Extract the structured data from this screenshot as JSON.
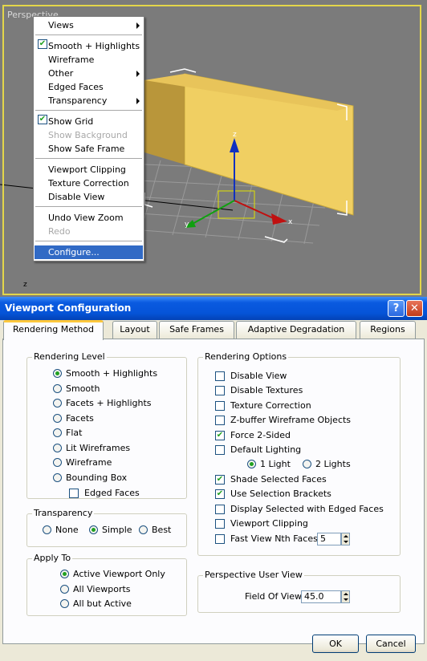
{
  "viewport": {
    "label": "Perspective",
    "axis_label_z": "z",
    "gizmo_z": "z",
    "gizmo_x": "x",
    "gizmo_y": "y"
  },
  "context_menu": {
    "items": [
      {
        "label": "Views",
        "checked": false,
        "disabled": false,
        "submenu": true
      },
      {
        "label": "Smooth + Highlights",
        "checked": true,
        "disabled": false,
        "submenu": false
      },
      {
        "label": "Wireframe",
        "checked": false,
        "disabled": false,
        "submenu": false
      },
      {
        "label": "Other",
        "checked": false,
        "disabled": false,
        "submenu": true
      },
      {
        "label": "Edged Faces",
        "checked": false,
        "disabled": false,
        "submenu": false
      },
      {
        "label": "Transparency",
        "checked": false,
        "disabled": false,
        "submenu": true
      },
      {
        "label": "Show Grid",
        "checked": true,
        "disabled": false,
        "submenu": false
      },
      {
        "label": "Show Background",
        "checked": false,
        "disabled": true,
        "submenu": false
      },
      {
        "label": "Show Safe Frame",
        "checked": false,
        "disabled": false,
        "submenu": false
      },
      {
        "label": "Viewport Clipping",
        "checked": false,
        "disabled": false,
        "submenu": false
      },
      {
        "label": "Texture Correction",
        "checked": false,
        "disabled": false,
        "submenu": false
      },
      {
        "label": "Disable View",
        "checked": false,
        "disabled": false,
        "submenu": false
      },
      {
        "label": "Undo View Zoom",
        "checked": false,
        "disabled": false,
        "submenu": false
      },
      {
        "label": "Redo",
        "checked": false,
        "disabled": true,
        "submenu": false
      },
      {
        "label": "Configure...",
        "checked": false,
        "disabled": false,
        "submenu": false,
        "highlighted": true
      }
    ],
    "check_glyph": "✔"
  },
  "dialog": {
    "title": "Viewport Configuration",
    "help_glyph": "?",
    "close_glyph": "✕",
    "tabs": [
      "Rendering Method",
      "Layout",
      "Safe Frames",
      "Adaptive Degradation",
      "Regions"
    ],
    "active_tab": "Rendering Method",
    "rendering_level": {
      "title": "Rendering Level",
      "options": [
        "Smooth + Highlights",
        "Smooth",
        "Facets + Highlights",
        "Facets",
        "Flat",
        "Lit Wireframes",
        "Wireframe",
        "Bounding Box"
      ],
      "selected": "Smooth + Highlights",
      "edged_faces": {
        "label": "Edged Faces",
        "checked": false
      }
    },
    "transparency": {
      "title": "Transparency",
      "options": [
        "None",
        "Simple",
        "Best"
      ],
      "selected": "Simple"
    },
    "apply_to": {
      "title": "Apply To",
      "options": [
        "Active Viewport Only",
        "All Viewports",
        "All but Active"
      ],
      "selected": "Active Viewport Only"
    },
    "rendering_options": {
      "title": "Rendering Options",
      "disable_view": {
        "label": "Disable View",
        "checked": false
      },
      "disable_textures": {
        "label": "Disable Textures",
        "checked": false
      },
      "texture_correction": {
        "label": "Texture Correction",
        "checked": false
      },
      "zbuffer_wireframe": {
        "label": "Z-buffer Wireframe Objects",
        "checked": false
      },
      "force_2sided": {
        "label": "Force 2-Sided",
        "checked": true
      },
      "default_lighting": {
        "label": "Default Lighting",
        "checked": false
      },
      "lights": {
        "options": [
          "1 Light",
          "2 Lights"
        ],
        "selected": "1 Light"
      },
      "shade_selected": {
        "label": "Shade Selected Faces",
        "checked": true
      },
      "selection_brackets": {
        "label": "Use Selection Brackets",
        "checked": true
      },
      "display_selected_edged": {
        "label": "Display Selected with Edged Faces",
        "checked": false
      },
      "viewport_clipping": {
        "label": "Viewport Clipping",
        "checked": false
      },
      "fast_view": {
        "label": "Fast View Nth Faces:",
        "checked": false,
        "value": "5"
      }
    },
    "perspective_user_view": {
      "title": "Perspective User View",
      "fov_label": "Field Of View:",
      "fov_value": "45.0"
    },
    "ok_label": "OK",
    "cancel_label": "Cancel",
    "check_glyph": "✔"
  }
}
